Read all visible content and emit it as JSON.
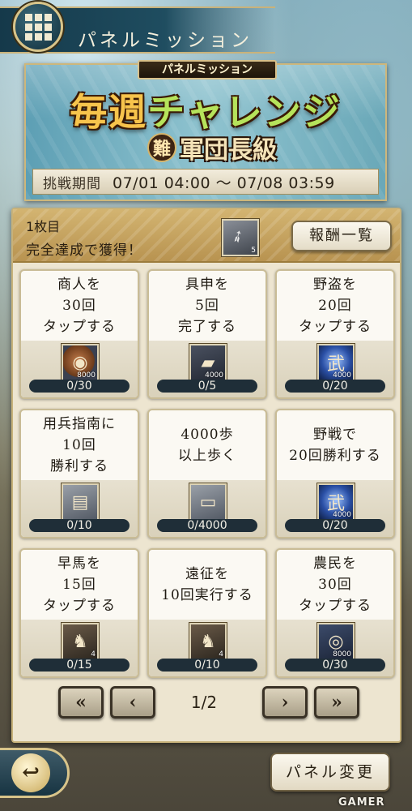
{
  "header": {
    "title": "パネルミッション",
    "menu_icon": "grid-icon"
  },
  "banner": {
    "tag": "パネルミッション",
    "title_part1": "毎週",
    "title_part2": "チャレンジ",
    "difficulty_badge": "難",
    "difficulty_text": "軍団長級",
    "period_label": "挑戦期間",
    "period_value": "07/01 04:00 ～ 07/08 03:59"
  },
  "panel": {
    "subtitle": "1枚目",
    "description": "完全達成で獲得！",
    "reward_count": "5",
    "reward_list_label": "報酬一覧"
  },
  "missions": [
    {
      "lines": [
        "商人を",
        "30回",
        "タップする"
      ],
      "icon": "coin-icon",
      "qty": "8000",
      "progress": "0/30"
    },
    {
      "lines": [
        "具申を",
        "5回",
        "完了する"
      ],
      "icon": "silver-ingot-icon",
      "qty": "4000",
      "progress": "0/5"
    },
    {
      "lines": [
        "野盗を",
        "20回",
        "タップする"
      ],
      "icon": "general-spirit-icon",
      "qty": "4000",
      "progress": "0/20"
    },
    {
      "lines": [
        "用兵指南に",
        "10回",
        "勝利する"
      ],
      "icon": "tickets-icon",
      "qty": "",
      "progress": "0/10"
    },
    {
      "lines": [
        "4000歩",
        "以上歩く"
      ],
      "icon": "ticket-icon",
      "qty": "",
      "progress": "0/4000"
    },
    {
      "lines": [
        "野戦で",
        "20回勝利する"
      ],
      "icon": "general-spirit-icon",
      "qty": "4000",
      "progress": "0/20"
    },
    {
      "lines": [
        "早馬を",
        "15回",
        "タップする"
      ],
      "icon": "horse-tag-icon",
      "qty": "4",
      "progress": "0/15"
    },
    {
      "lines": [
        "遠征を",
        "10回実行する"
      ],
      "icon": "horse-tag-icon",
      "qty": "4",
      "progress": "0/10"
    },
    {
      "lines": [
        "農民を",
        "30回",
        "タップする"
      ],
      "icon": "rice-bales-icon",
      "qty": "8000",
      "progress": "0/30"
    }
  ],
  "pager": {
    "page_indicator": "1/2",
    "first": "«",
    "prev": "‹",
    "next": "›",
    "last": "»"
  },
  "footer": {
    "back_icon": "back-arrow-icon",
    "panel_change_label": "パネル変更",
    "watermark": "GAMER"
  }
}
